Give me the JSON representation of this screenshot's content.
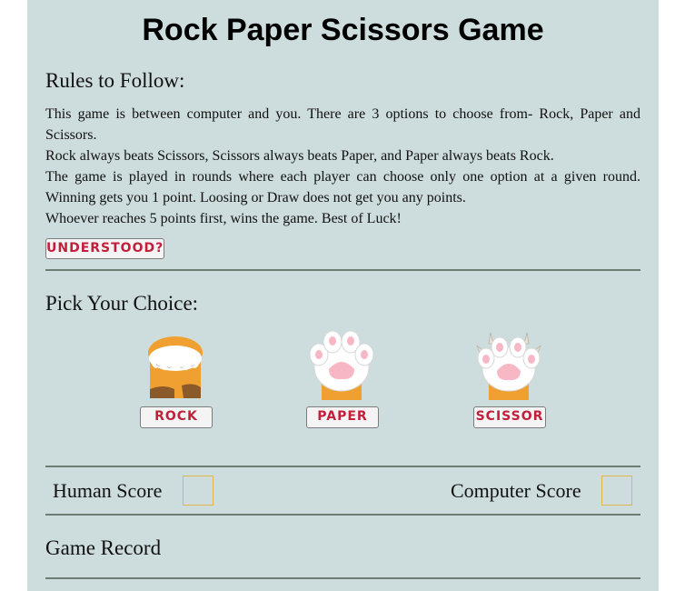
{
  "title": "Rock Paper Scissors Game",
  "rules": {
    "heading": "Rules to Follow:",
    "lines": [
      "This game is between computer and you. There are 3 options to choose from- Rock, Paper and Scissors.",
      "Rock always beats Scissors, Scissors always beats Paper, and Paper always beats Rock.",
      "The game is played in rounds where each player can choose only one option at a given round. Winning gets you 1 point. Loosing or Draw does not get you any points.",
      "Whoever reaches 5 points first, wins the game. Best of Luck!"
    ],
    "understood_label": "UNDERSTOOD?"
  },
  "choice": {
    "heading": "Pick Your Choice:",
    "options": [
      {
        "label": "ROCK",
        "icon": "rock-paw-icon"
      },
      {
        "label": "PAPER",
        "icon": "paper-paw-icon"
      },
      {
        "label": "SCISSOR",
        "icon": "scissor-paw-icon"
      }
    ]
  },
  "scores": {
    "human_label": "Human Score",
    "human_value": "",
    "computer_label": "Computer Score",
    "computer_value": ""
  },
  "record": {
    "heading": "Game Record"
  },
  "colors": {
    "panel_bg": "#cddcdc",
    "button_text": "#c21f3a",
    "score_box_border": "#e0b54b",
    "paw_orange": "#f0a030",
    "paw_pad_pink": "#f7b7c4"
  }
}
